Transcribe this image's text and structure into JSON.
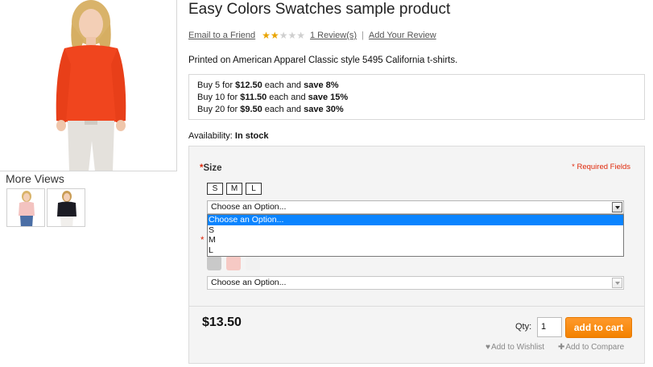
{
  "product": {
    "name": "Easy Colors Swatches sample product",
    "short_description": "Printed on American Apparel Classic style 5495 California t-shirts.",
    "email_friend": "Email to a Friend",
    "reviews_link": "1 Review(s)",
    "add_review": "Add Your Review",
    "rating": {
      "value": 2,
      "max": 5
    }
  },
  "gallery": {
    "more_views_title": "More Views",
    "thumbnails": [
      "pink-sweater",
      "black-sweater"
    ]
  },
  "tier_prices": [
    {
      "prefix": "Buy 5 for ",
      "price": "$12.50",
      "mid": " each and ",
      "save": "save 8%"
    },
    {
      "prefix": "Buy 10 for ",
      "price": "$11.50",
      "mid": " each and ",
      "save": "save 15%"
    },
    {
      "prefix": "Buy 20 for ",
      "price": "$9.50",
      "mid": " each and ",
      "save": "save 30%"
    }
  ],
  "availability": {
    "label": "Availability:",
    "value": "In stock"
  },
  "options": {
    "required_note": "* Required Fields",
    "size": {
      "star": "*",
      "label": "Size",
      "swatches": [
        "S",
        "M",
        "L"
      ],
      "select_value": "Choose an Option...",
      "dropdown_options": [
        "Choose an Option...",
        "S",
        "M",
        "L"
      ],
      "highlighted_index": 0
    },
    "color": {
      "star": "*",
      "swatch_colors": [
        "#c9c9c9",
        "#f6c9c4",
        "#f1f1f1"
      ],
      "select_value": "Choose an Option..."
    }
  },
  "cart": {
    "price": "$13.50",
    "qty_label": "Qty:",
    "qty_value": "1",
    "add_to_cart": "add to cart",
    "wishlist": "Add to Wishlist",
    "compare": "Add to Compare"
  },
  "colors": {
    "accent_orange": "#f38200",
    "required_red": "#df280a",
    "highlight_blue": "#0a84ff",
    "star_gold": "#e9a400"
  }
}
